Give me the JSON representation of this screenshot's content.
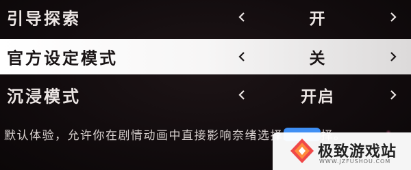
{
  "settings": {
    "rows": [
      {
        "label": "引导探索",
        "value": "开",
        "selected": false
      },
      {
        "label": "官方设定模式",
        "value": "关",
        "selected": true
      },
      {
        "label": "沉浸模式",
        "value": "开启",
        "selected": false
      }
    ],
    "left_arrow": "‹",
    "right_arrow": "›"
  },
  "description": "默认体验，允许你在剧情动画中直接影响奈绪选择。的选择。",
  "watermark": {
    "title": "极致游戏站",
    "url": "WWW.JZFUSHOU.COM"
  },
  "colors": {
    "background": "#120c0e",
    "selected_row": "#f5f4f4",
    "text_light": "#ece6e4",
    "text_dark": "#1a1516",
    "bubble": "#3f8ff4"
  }
}
